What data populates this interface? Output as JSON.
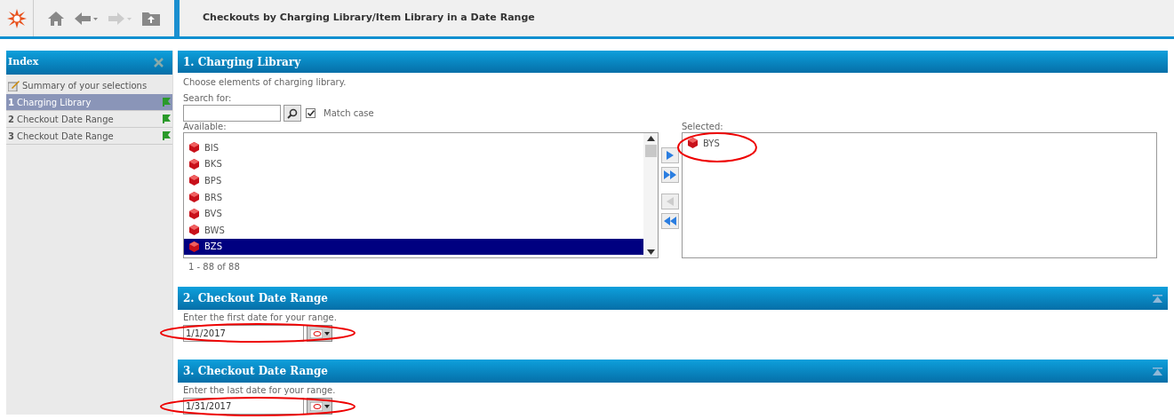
{
  "toolbar": {
    "title": "Checkouts by Charging Library/Item Library in a Date Range"
  },
  "sidebar": {
    "title": "Index",
    "items": [
      {
        "label": "Summary of your selections",
        "kind": "summary",
        "selected": false
      },
      {
        "number": "1",
        "label": "Charging Library",
        "kind": "step",
        "selected": true
      },
      {
        "number": "2",
        "label": "Checkout Date Range",
        "kind": "step",
        "selected": false
      },
      {
        "number": "3",
        "label": "Checkout Date Range",
        "kind": "step",
        "selected": false
      }
    ]
  },
  "charging_library": {
    "title": "1. Charging Library",
    "description": "Choose elements of charging library.",
    "search_label": "Search for:",
    "match_case": {
      "label": "Match case",
      "checked": true
    },
    "available_label": "Available:",
    "available": [
      {
        "label": "BIS",
        "selected": false
      },
      {
        "label": "BKS",
        "selected": false
      },
      {
        "label": "BPS",
        "selected": false
      },
      {
        "label": "BRS",
        "selected": false
      },
      {
        "label": "BVS",
        "selected": false
      },
      {
        "label": "BWS",
        "selected": false
      },
      {
        "label": "BZS",
        "selected": true
      }
    ],
    "count": "1 - 88 of 88",
    "selected_label": "Selected:",
    "selected": [
      {
        "label": "BYS"
      }
    ],
    "circled": true
  },
  "date_sections": [
    {
      "title": "2. Checkout Date Range",
      "description": "Enter the first date for your range.",
      "value": "1/1/2017",
      "circled": true
    },
    {
      "title": "3. Checkout Date Range",
      "description": "Enter the last date for your range.",
      "value": "1/31/2017",
      "circled": true
    }
  ]
}
